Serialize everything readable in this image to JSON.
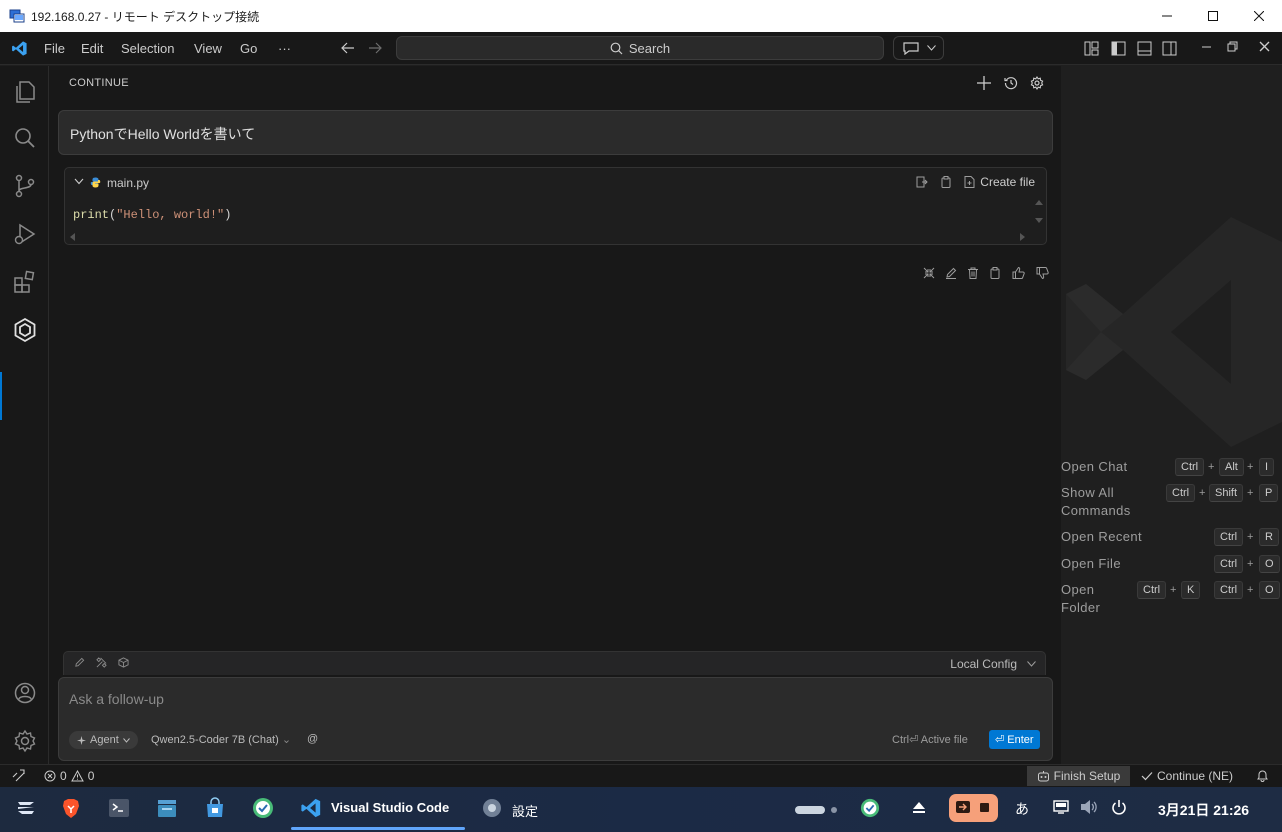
{
  "window": {
    "title": "192.168.0.27 - リモート デスクトップ接続",
    "controls": [
      "minimize-icon",
      "maximize-icon",
      "close-icon"
    ]
  },
  "menubar": {
    "items": [
      "File",
      "Edit",
      "Selection",
      "View",
      "Go",
      "···"
    ],
    "search_label": "Search"
  },
  "activity_bar": {
    "items": [
      "explorer-icon",
      "search-icon",
      "source-control-icon",
      "run-debug-icon",
      "extensions-icon",
      "continue-icon"
    ],
    "bottom": [
      "account-icon",
      "manage-gear-icon"
    ],
    "active": "continue-icon"
  },
  "chat": {
    "panel_title": "CONTINUE",
    "user_message": "PythonでHello Worldを書いて",
    "code_block": {
      "filename": "main.py",
      "create_file_label": "Create file",
      "code_fn": "print",
      "code_open": "(",
      "code_str": "\"Hello, world!\"",
      "code_close": ")"
    },
    "input": {
      "placeholder": "Ask a follow-up",
      "config_label": "Local Config",
      "mode_label": "Agent",
      "model_label": "Qwen2.5-Coder 7B (Chat)",
      "at_label": "@",
      "active_file_label": "Ctrl⏎ Active file",
      "enter_label": "⏎ Enter"
    }
  },
  "welcome": {
    "shortcuts": [
      {
        "label": "Open Chat",
        "keys": [
          "Ctrl",
          "Alt",
          "I"
        ]
      },
      {
        "label": "Show All Commands",
        "keys": [
          "Ctrl",
          "Shift",
          "P"
        ]
      },
      {
        "label": "Open Recent",
        "keys": [
          "Ctrl",
          "R"
        ]
      },
      {
        "label": "Open File",
        "keys": [
          "Ctrl",
          "O"
        ]
      },
      {
        "label": "Open Folder",
        "keys": [
          "Ctrl",
          "K",
          "Ctrl",
          "O"
        ]
      }
    ]
  },
  "statusbar": {
    "errors": "0",
    "warnings": "0",
    "finish_setup": "Finish Setup",
    "continue_label": "Continue (NE)"
  },
  "taskbar": {
    "active_app": "Visual Studio Code",
    "settings_app": "設定",
    "ime": "あ",
    "clock": "3月21日  21:26"
  },
  "colors": {
    "accent": "#0078d4",
    "string": "#ce9178",
    "function": "#dcdcaa"
  }
}
